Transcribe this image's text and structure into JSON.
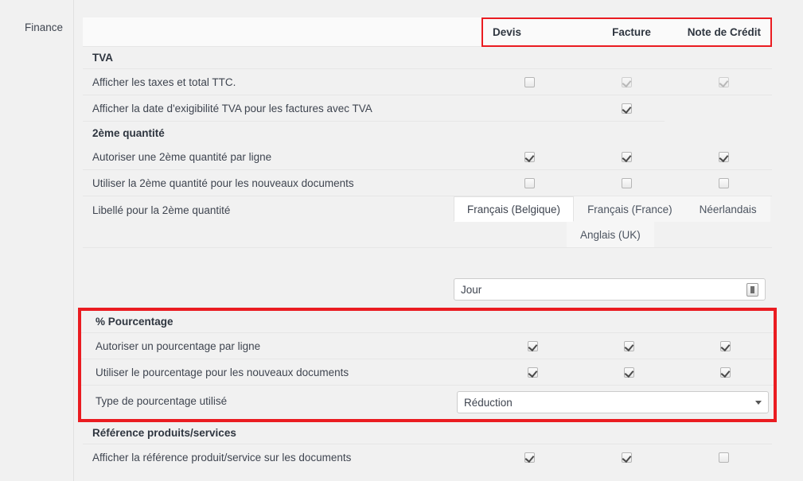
{
  "sidebar": {
    "label": "Finance"
  },
  "columns": [
    "Devis",
    "Facture",
    "Note de Crédit"
  ],
  "sections": {
    "tva": {
      "title": "TVA",
      "rows": [
        {
          "label": "Afficher les taxes et total TTC.",
          "states": [
            "unchecked",
            "checked-dim",
            "checked-dim"
          ]
        },
        {
          "label": "Afficher la date d'exigibilité TVA pour les factures avec TVA",
          "states": [
            "none",
            "checked",
            "none"
          ]
        }
      ]
    },
    "quantity": {
      "title": "2ème quantité",
      "rows": [
        {
          "label": "Autoriser une 2ème quantité par ligne",
          "states": [
            "checked",
            "checked",
            "checked"
          ]
        },
        {
          "label": "Utiliser la 2ème quantité pour les nouveaux documents",
          "states": [
            "unchecked",
            "unchecked",
            "unchecked"
          ]
        }
      ],
      "label_row": {
        "label": "Libellé pour la 2ème quantité",
        "tabs": [
          "Français (Belgique)",
          "Français (France)",
          "Néerlandais",
          "Anglais (UK)"
        ],
        "active_tab": "Français (Belgique)",
        "input_value": "Jour",
        "input_icon": "translate-icon"
      }
    },
    "percentage": {
      "title": "% Pourcentage",
      "rows": [
        {
          "label": "Autoriser un pourcentage par ligne",
          "states": [
            "checked",
            "checked",
            "checked"
          ]
        },
        {
          "label": "Utiliser le pourcentage pour les nouveaux documents",
          "states": [
            "checked",
            "checked",
            "checked"
          ]
        }
      ],
      "select_row": {
        "label": "Type de pourcentage utilisé",
        "value": "Réduction",
        "caret": "chevron-down-icon"
      },
      "highlight_color": "#ea1c21"
    },
    "reference": {
      "title": "Référence produits/services",
      "rows": [
        {
          "label": "Afficher la référence produit/service sur les documents",
          "states": [
            "checked",
            "checked",
            "unchecked"
          ]
        }
      ]
    }
  }
}
